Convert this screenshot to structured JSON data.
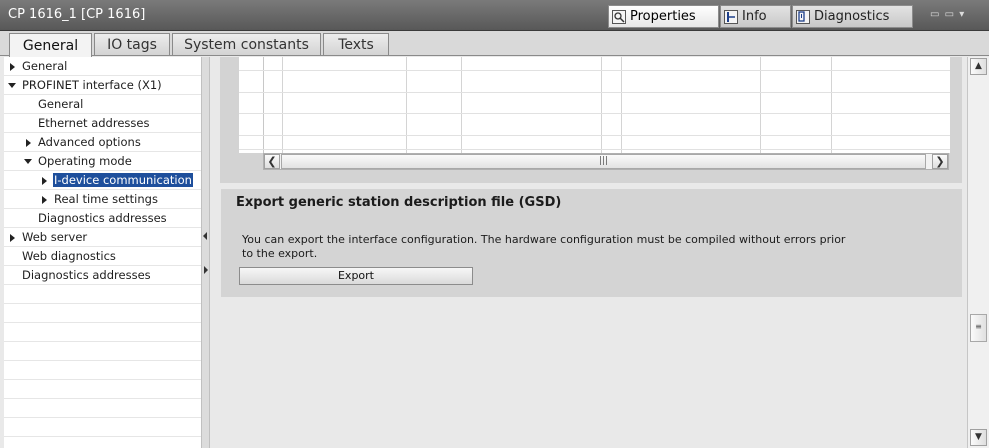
{
  "window": {
    "title": "CP 1616_1 [CP 1616]"
  },
  "inspector_tabs": [
    {
      "label": "Properties",
      "icon": "properties-icon",
      "active": true
    },
    {
      "label": "Info",
      "icon": "info-icon",
      "active": false
    },
    {
      "label": "Diagnostics",
      "icon": "diagnostics-icon",
      "active": false
    }
  ],
  "tabs": [
    {
      "label": "General",
      "active": true
    },
    {
      "label": "IO tags",
      "active": false
    },
    {
      "label": "System constants",
      "active": false
    },
    {
      "label": "Texts",
      "active": false
    }
  ],
  "tree": [
    {
      "label": "General",
      "level": 0,
      "expander": "collapsed"
    },
    {
      "label": "PROFINET interface (X1)",
      "level": 0,
      "expander": "expanded"
    },
    {
      "label": "General",
      "level": 1,
      "expander": "none"
    },
    {
      "label": "Ethernet addresses",
      "level": 1,
      "expander": "none"
    },
    {
      "label": "Advanced options",
      "level": 1,
      "expander": "collapsed"
    },
    {
      "label": "Operating mode",
      "level": 1,
      "expander": "expanded"
    },
    {
      "label": "I-device communication",
      "level": 2,
      "expander": "collapsed",
      "selected": true
    },
    {
      "label": "Real time settings",
      "level": 2,
      "expander": "collapsed"
    },
    {
      "label": "Diagnostics addresses",
      "level": 1,
      "expander": "none"
    },
    {
      "label": "Web server",
      "level": 0,
      "expander": "collapsed"
    },
    {
      "label": "Web diagnostics",
      "level": 0,
      "expander": "none"
    },
    {
      "label": "Diagnostics addresses",
      "level": 0,
      "expander": "none"
    }
  ],
  "export_section": {
    "heading": "Export generic station description file (GSD)",
    "description": "You can export the interface configuration. The hardware configuration must be compiled without errors prior to the export.",
    "button_label": "Export"
  },
  "colors": {
    "selection": "#1e4f9c",
    "titlebar": "#666666",
    "panel": "#d4d4d4"
  }
}
